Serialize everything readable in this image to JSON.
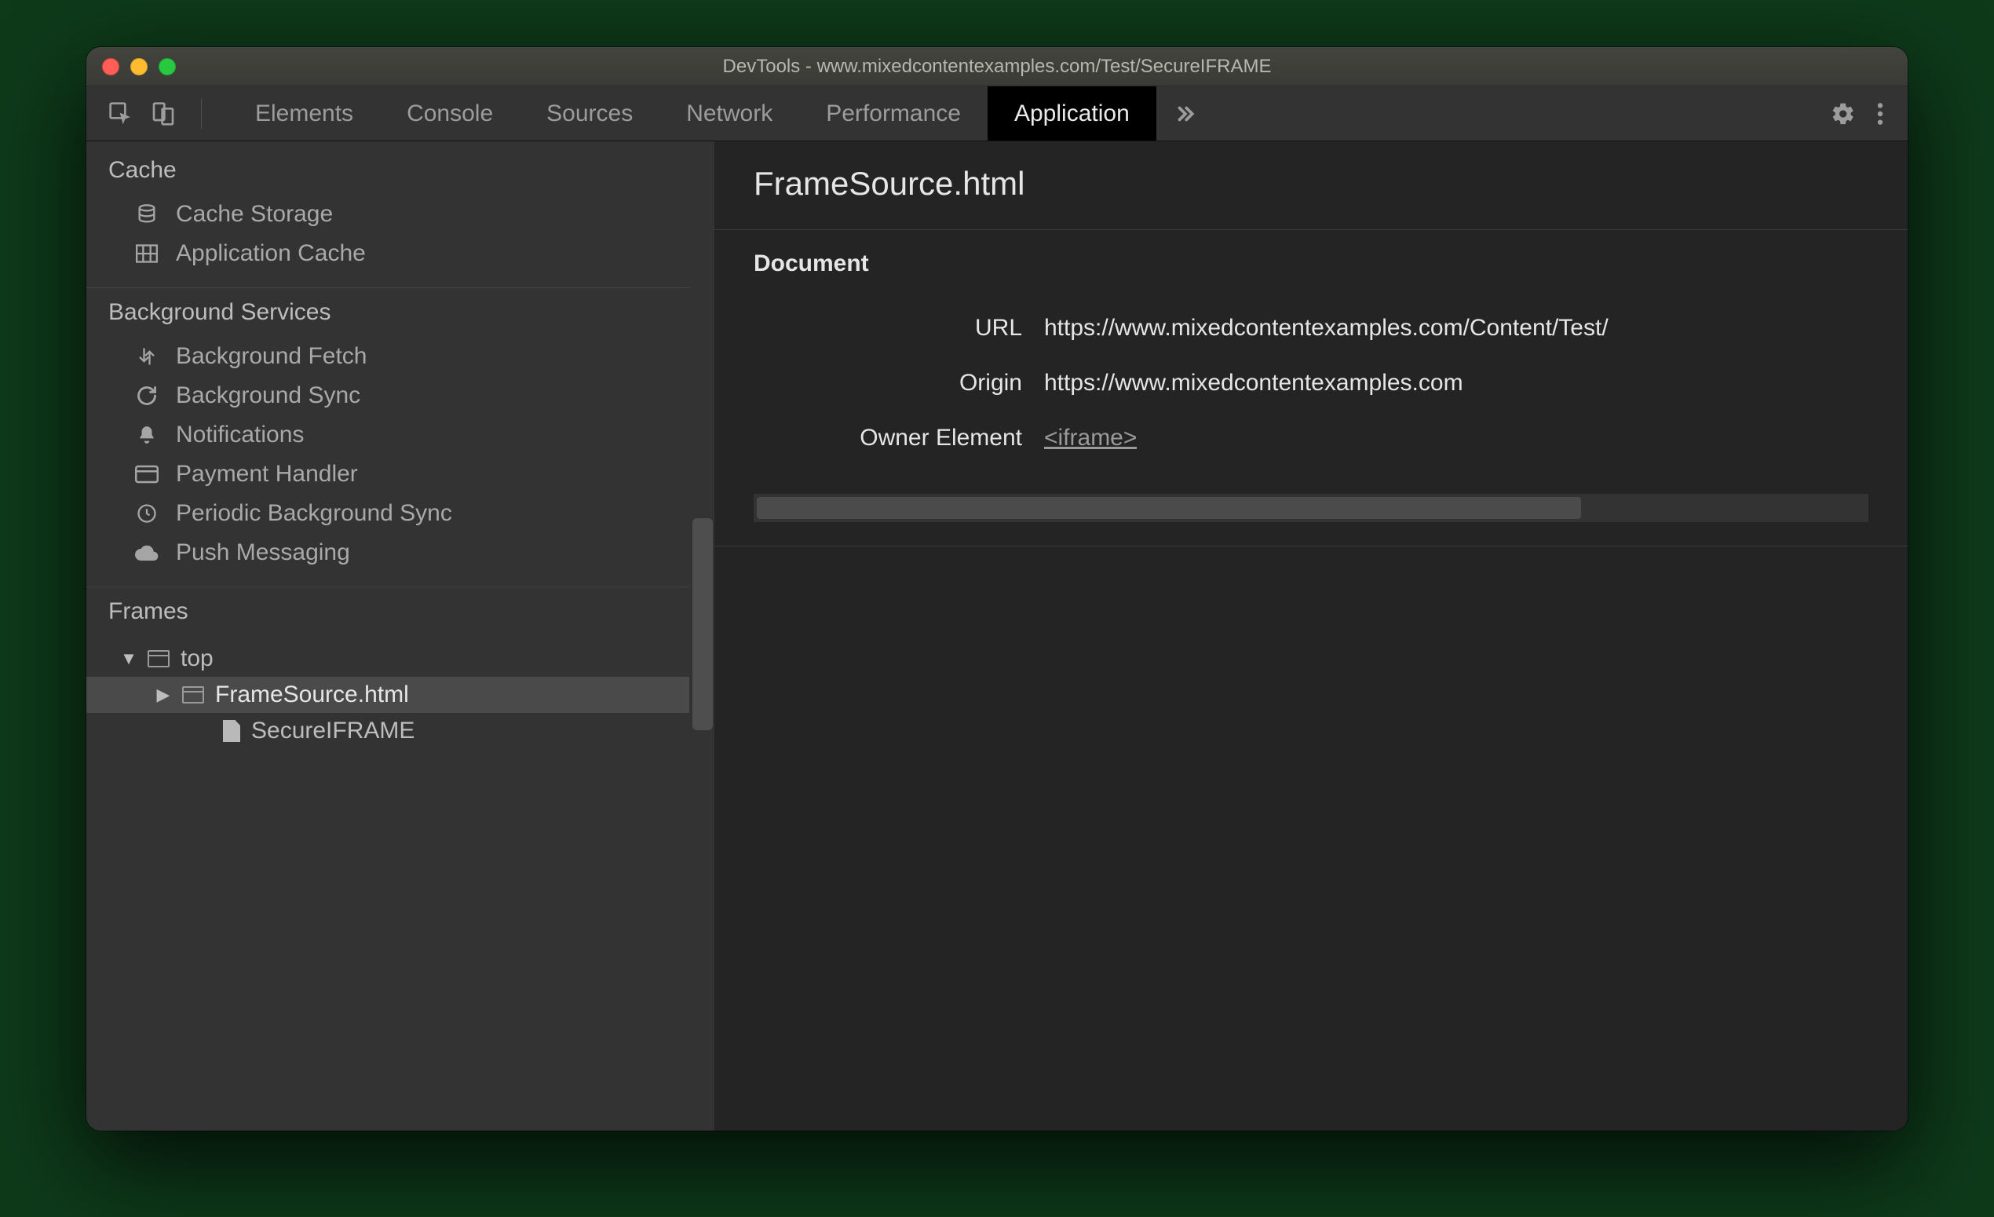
{
  "window": {
    "title": "DevTools - www.mixedcontentexamples.com/Test/SecureIFRAME"
  },
  "tabs": {
    "items": [
      "Elements",
      "Console",
      "Sources",
      "Network",
      "Performance",
      "Application"
    ],
    "active": "Application"
  },
  "sidebar": {
    "cache": {
      "title": "Cache",
      "items": [
        "Cache Storage",
        "Application Cache"
      ]
    },
    "background_services": {
      "title": "Background Services",
      "items": [
        "Background Fetch",
        "Background Sync",
        "Notifications",
        "Payment Handler",
        "Periodic Background Sync",
        "Push Messaging"
      ]
    },
    "frames": {
      "title": "Frames",
      "top": "top",
      "child1": "FrameSource.html",
      "child2": "SecureIFRAME"
    }
  },
  "main": {
    "title": "FrameSource.html",
    "document_heading": "Document",
    "url_label": "URL",
    "url_value": "https://www.mixedcontentexamples.com/Content/Test/",
    "origin_label": "Origin",
    "origin_value": "https://www.mixedcontentexamples.com",
    "owner_label": "Owner Element",
    "owner_value": "<iframe>"
  }
}
